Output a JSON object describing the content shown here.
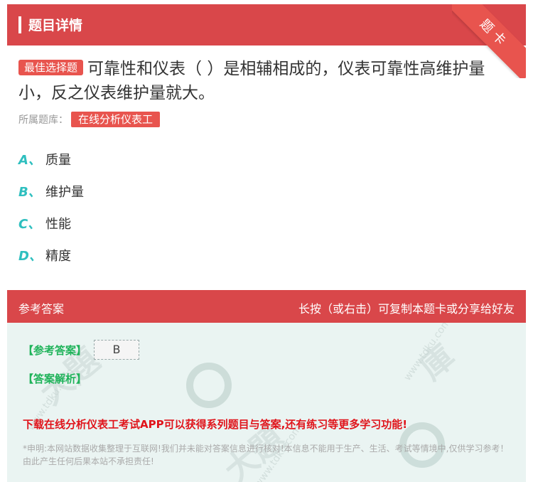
{
  "header": {
    "title": "题目详情",
    "corner_badge": "题卡"
  },
  "question": {
    "type_tag": "最佳选择题",
    "text": "可靠性和仪表（ ）是相辅相成的，仪表可靠性高维护量小，反之仪表维护量就大。",
    "library_label": "所属题库：",
    "library_name": "在线分析仪表工"
  },
  "options": [
    {
      "letter": "A、",
      "text": "质量"
    },
    {
      "letter": "B、",
      "text": "维护量"
    },
    {
      "letter": "C、",
      "text": "性能"
    },
    {
      "letter": "D、",
      "text": "精度"
    }
  ],
  "answer_section": {
    "title": "参考答案",
    "share_hint": "长按（或右击）可复制本题卡或分享给好友",
    "ref_answer_label": "【参考答案】",
    "ref_answer_value": "B",
    "explanation_label": "【答案解析】",
    "download_text": "下载在线分析仪表工考试APP可以获得系列题目与答案,还有练习等更多学习功能!",
    "disclaimer": "*申明:本网站数据收集整理于互联网!我们并未能对答案信息进行核对!本信息不能用于生产、生活、考试等情境中,仅供学习参考！由此产生任何后果本站不承担责任!"
  },
  "colors": {
    "header_red": "#d9474a",
    "tag_red": "#e8544e",
    "option_teal": "#2fbfbf",
    "answer_green": "#1fb35a",
    "answer_bg": "#eaf4f2"
  }
}
